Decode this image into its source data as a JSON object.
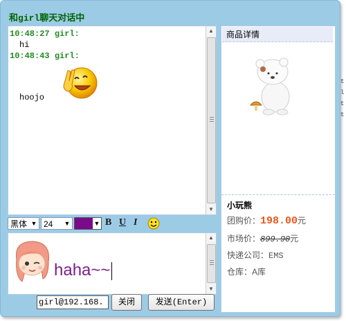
{
  "title": {
    "prefix": "和",
    "name": "girl",
    "suffix": "聊天对话中"
  },
  "messages": [
    {
      "time": "10:48:27",
      "sender": "girl:",
      "text": "hi"
    },
    {
      "time": "10:48:43",
      "sender": "girl:",
      "text": "hoojo"
    }
  ],
  "toolbar": {
    "font_family": "黑体",
    "font_size": "24",
    "text_color": "#7b0a8a",
    "bold_label": "B",
    "underline_label": "U",
    "italic_label": "I",
    "emoji_icon": "smiley-icon"
  },
  "input": {
    "text": "haha~~"
  },
  "footer": {
    "address": "girl@192.168.",
    "close_label": "关闭",
    "send_label": "发送(Enter)"
  },
  "product": {
    "header": "商品详情",
    "name": "小玩熊",
    "group_price_label": "团购价：",
    "group_price": "198.00",
    "group_price_unit": "元",
    "market_price_label": "市场价：",
    "market_price": "899.90",
    "market_price_unit": "元",
    "courier_label": "快递公司：",
    "courier": "EMS",
    "warehouse_label": "仓库：",
    "warehouse": "A库"
  },
  "background_glyphs": [
    "t",
    "l",
    "t",
    "t"
  ]
}
